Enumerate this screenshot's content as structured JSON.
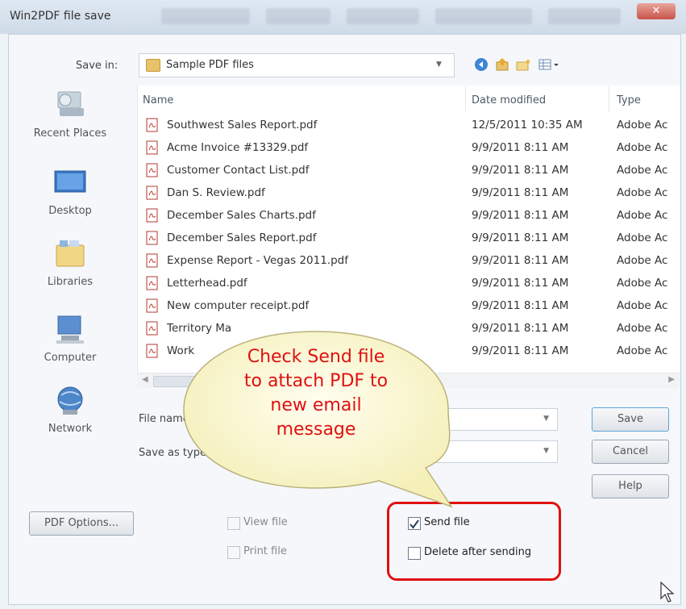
{
  "window": {
    "title": "Win2PDF file save",
    "close_label": "✕"
  },
  "save_in": {
    "label": "Save in:",
    "value": "Sample PDF files"
  },
  "toolbar": {
    "icons": [
      "back-icon",
      "up-folder-icon",
      "new-folder-icon",
      "view-menu-icon"
    ]
  },
  "places": [
    {
      "label": "Recent Places",
      "icon": "recent-places-icon"
    },
    {
      "label": "Desktop",
      "icon": "desktop-icon"
    },
    {
      "label": "Libraries",
      "icon": "libraries-icon"
    },
    {
      "label": "Computer",
      "icon": "computer-icon"
    },
    {
      "label": "Network",
      "icon": "network-icon"
    }
  ],
  "file_list": {
    "columns": [
      "Name",
      "Date modified",
      "Type"
    ],
    "rows": [
      {
        "name": "Southwest Sales Report.pdf",
        "date": "12/5/2011 10:35 AM",
        "type": "Adobe Ac"
      },
      {
        "name": "Acme Invoice #13329.pdf",
        "date": "9/9/2011 8:11 AM",
        "type": "Adobe Ac"
      },
      {
        "name": "Customer Contact List.pdf",
        "date": "9/9/2011 8:11 AM",
        "type": "Adobe Ac"
      },
      {
        "name": "Dan S. Review.pdf",
        "date": "9/9/2011 8:11 AM",
        "type": "Adobe Ac"
      },
      {
        "name": "December Sales Charts.pdf",
        "date": "9/9/2011 8:11 AM",
        "type": "Adobe Ac"
      },
      {
        "name": "December Sales Report.pdf",
        "date": "9/9/2011 8:11 AM",
        "type": "Adobe Ac"
      },
      {
        "name": "Expense Report - Vegas 2011.pdf",
        "date": "9/9/2011 8:11 AM",
        "type": "Adobe Ac"
      },
      {
        "name": "Letterhead.pdf",
        "date": "9/9/2011 8:11 AM",
        "type": "Adobe Ac"
      },
      {
        "name": "New computer receipt.pdf",
        "date": "9/9/2011 8:11 AM",
        "type": "Adobe Ac"
      },
      {
        "name": "Territory Ma",
        "date": "9/9/2011 8:11 AM",
        "type": "Adobe Ac"
      },
      {
        "name": "Work",
        "date": "9/9/2011 8:11 AM",
        "type": "Adobe Ac"
      }
    ]
  },
  "file_name": {
    "label": "File name",
    "value": ""
  },
  "save_as_type": {
    "label": "Save as type",
    "value": ""
  },
  "buttons": {
    "save": "Save",
    "cancel": "Cancel",
    "help": "Help",
    "pdf_options": "PDF Options..."
  },
  "options": {
    "view_file": {
      "label": "View file",
      "checked": false
    },
    "print_file": {
      "label": "Print file",
      "checked": false
    },
    "send_file": {
      "label": "Send file",
      "checked": true
    },
    "delete_after_sending": {
      "label": "Delete after sending",
      "checked": false
    }
  },
  "callout": {
    "lines": [
      "Check Send file",
      "to attach PDF to",
      "new email",
      "message"
    ],
    "color": "#e01010"
  },
  "colors": {
    "highlight": "#e01010",
    "bubble_fill": "#fbf8d6"
  }
}
